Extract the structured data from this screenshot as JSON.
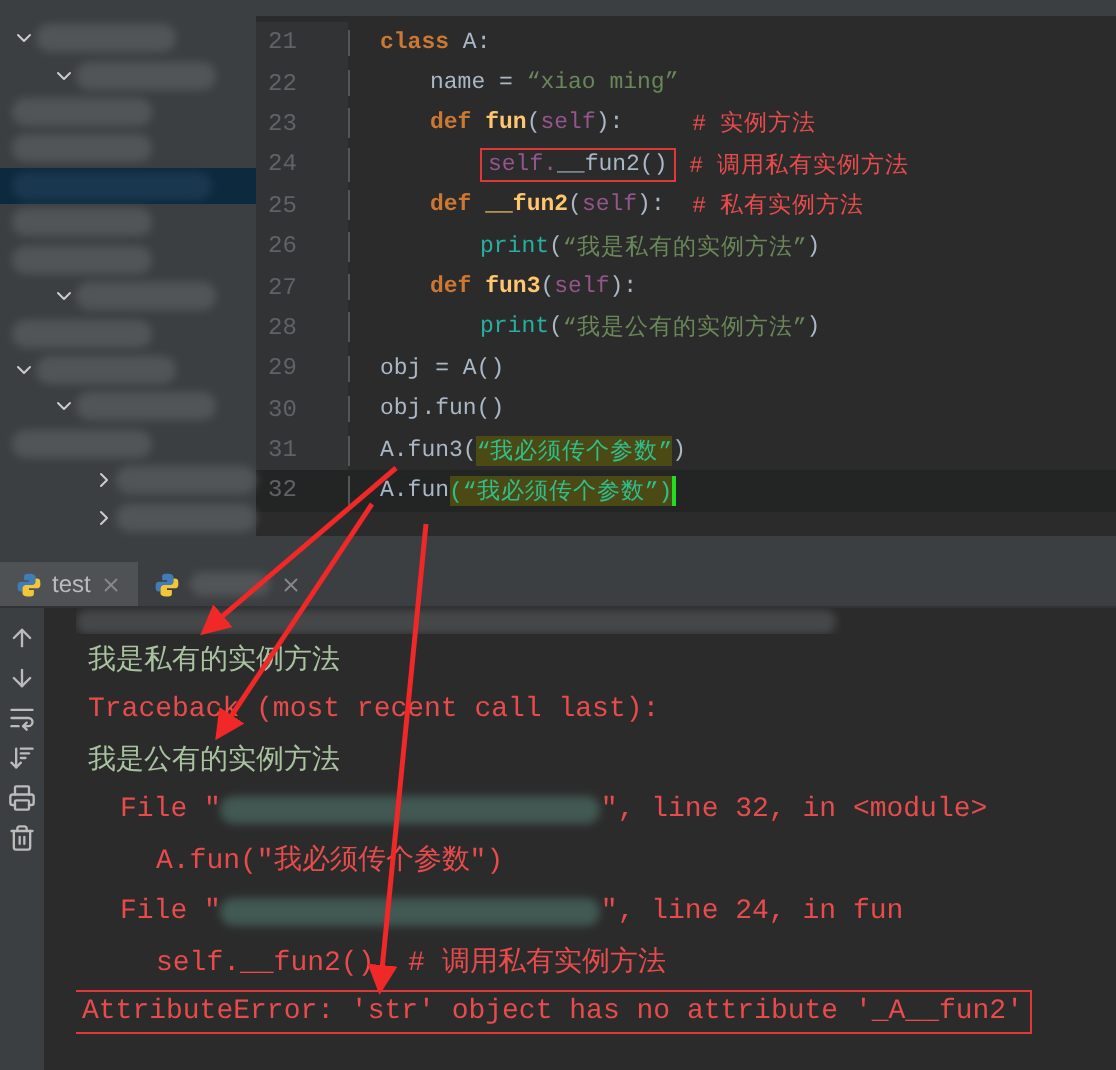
{
  "editor": {
    "lines": [
      {
        "number": "21",
        "tokens": [
          {
            "kind": "keyword",
            "text": "class"
          },
          {
            "kind": "plain",
            "text": " A:"
          }
        ],
        "children": [
          {
            "number": "22",
            "tokens": [
              {
                "kind": "plain",
                "text": "name = "
              },
              {
                "kind": "string",
                "text": "“xiao ming”"
              }
            ]
          },
          {
            "number": "23",
            "tokens": [
              {
                "kind": "keyword",
                "text": "def"
              },
              {
                "kind": "name",
                "text": " fun"
              },
              {
                "kind": "plain",
                "text": "("
              },
              {
                "kind": "self",
                "text": "self"
              },
              {
                "kind": "plain",
                "text": "):     "
              },
              {
                "kind": "comment",
                "text": "# 实例方法"
              }
            ],
            "children": [
              {
                "number": "24",
                "tokens": [
                  {
                    "kind": "boxed",
                    "parts": [
                      {
                        "kind": "self",
                        "text": "self."
                      },
                      {
                        "kind": "plain",
                        "text": "__fun2()"
                      }
                    ]
                  },
                  {
                    "kind": "comment",
                    "text": " # 调用私有实例方法"
                  }
                ]
              }
            ]
          },
          {
            "number": "25",
            "tokens": [
              {
                "kind": "keyword",
                "text": "def"
              },
              {
                "kind": "name",
                "text": " __fun2"
              },
              {
                "kind": "plain",
                "text": "("
              },
              {
                "kind": "self",
                "text": "self"
              },
              {
                "kind": "plain",
                "text": "):  "
              },
              {
                "kind": "comment",
                "text": "# 私有实例方法"
              }
            ],
            "children": [
              {
                "number": "26",
                "tokens": [
                  {
                    "kind": "builtin",
                    "text": "print"
                  },
                  {
                    "kind": "plain",
                    "text": "("
                  },
                  {
                    "kind": "string",
                    "text": "“我是私有的实例方法”"
                  },
                  {
                    "kind": "plain",
                    "text": ")"
                  }
                ]
              }
            ]
          },
          {
            "number": "27",
            "tokens": [
              {
                "kind": "keyword",
                "text": "def"
              },
              {
                "kind": "name",
                "text": " fun3"
              },
              {
                "kind": "plain",
                "text": "("
              },
              {
                "kind": "self",
                "text": "self"
              },
              {
                "kind": "plain",
                "text": "):"
              }
            ],
            "children": [
              {
                "number": "28",
                "tokens": [
                  {
                    "kind": "builtin",
                    "text": "print"
                  },
                  {
                    "kind": "plain",
                    "text": "("
                  },
                  {
                    "kind": "string",
                    "text": "“我是公有的实例方法”"
                  },
                  {
                    "kind": "plain",
                    "text": ")"
                  }
                ]
              }
            ]
          }
        ]
      },
      {
        "number": "29",
        "tokens": [
          {
            "kind": "plain",
            "text": "obj = A()"
          }
        ]
      },
      {
        "number": "30",
        "tokens": [
          {
            "kind": "plain",
            "text": "obj.fun()"
          }
        ]
      },
      {
        "number": "31",
        "tokens": [
          {
            "kind": "plain",
            "text": "A.fun3("
          },
          {
            "kind": "marked",
            "text": "“我必须传个参数”"
          },
          {
            "kind": "plain",
            "text": ")"
          }
        ]
      },
      {
        "number": "32",
        "current": true,
        "tokens": [
          {
            "kind": "plain",
            "text": "A.fun"
          },
          {
            "kind": "marked",
            "text": "(“我必须传个参数”)"
          }
        ]
      }
    ]
  },
  "run_tabs": [
    {
      "label": "test",
      "selected": true
    },
    {
      "selected": false
    }
  ],
  "output": [
    {
      "kind": "blurred"
    },
    {
      "kind": "stdout",
      "text": "我是私有的实例方法"
    },
    {
      "kind": "error",
      "text": "Traceback (most recent call last):"
    },
    {
      "kind": "stdout",
      "text": "我是公有的实例方法"
    },
    {
      "kind": "file",
      "prefix": "File \"",
      "suffix": "\", line 32, in <module>"
    },
    {
      "kind": "source",
      "text": "A.fun(\"我必须传个参数\")"
    },
    {
      "kind": "file",
      "prefix": "File \"",
      "suffix": "\", line 24, in fun"
    },
    {
      "kind": "source",
      "text": "self.__fun2()  # 调用私有实例方法"
    },
    {
      "kind": "boxed_error",
      "text": "AttributeError: 'str' object has no attribute '_A__fun2'"
    }
  ]
}
